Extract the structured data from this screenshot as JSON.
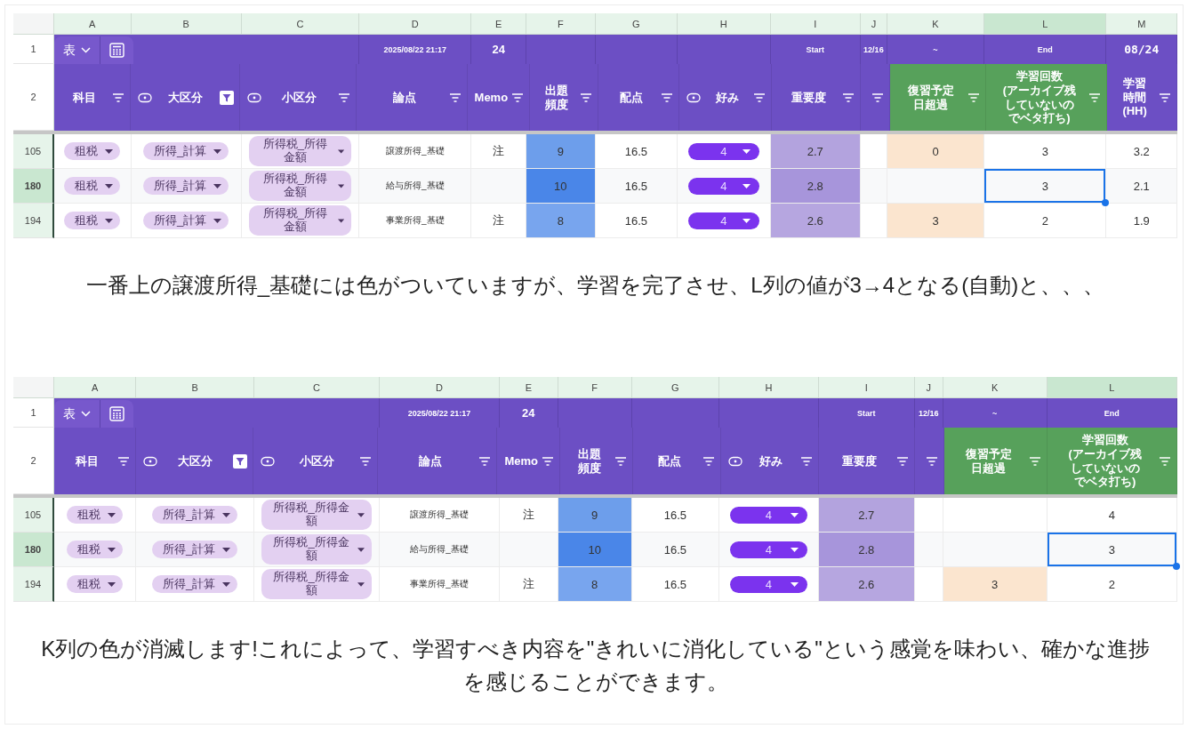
{
  "blocks": [
    {
      "kind": "sheet",
      "columns": [
        {
          "letter": "A",
          "selected": false
        },
        {
          "letter": "B",
          "selected": false
        },
        {
          "letter": "C",
          "selected": false
        },
        {
          "letter": "D",
          "selected": false
        },
        {
          "letter": "E",
          "selected": false
        },
        {
          "letter": "F",
          "selected": false
        },
        {
          "letter": "G",
          "selected": false
        },
        {
          "letter": "H",
          "selected": false
        },
        {
          "letter": "I",
          "selected": false
        },
        {
          "letter": "J",
          "selected": false
        },
        {
          "letter": "K",
          "selected": false
        },
        {
          "letter": "L",
          "selected": true
        },
        {
          "letter": "M",
          "selected": false
        }
      ],
      "row1": {
        "number": "1",
        "cells": [
          {
            "kind": "toolbar",
            "label": "表"
          },
          {
            "kind": "empty"
          },
          {
            "kind": "small",
            "text": "2025/08/22 21:17"
          },
          {
            "kind": "bold",
            "text": "24"
          },
          {
            "kind": "empty"
          },
          {
            "kind": "empty"
          },
          {
            "kind": "empty"
          },
          {
            "kind": "small",
            "text": "Start"
          },
          {
            "kind": "small",
            "text": "12/16"
          },
          {
            "kind": "small",
            "text": "~"
          },
          {
            "kind": "small",
            "text": "End"
          },
          {
            "kind": "mono",
            "text": "08/24"
          }
        ]
      },
      "row2": {
        "number": "2",
        "cells": [
          {
            "label": [
              "科目"
            ],
            "filtered": false,
            "color": "#6c4fc4"
          },
          {
            "label": [
              "大区分"
            ],
            "chip_icon": true,
            "filtered": true,
            "color": "#6c4fc4"
          },
          {
            "label": [
              "小区分"
            ],
            "chip_icon": true,
            "filtered": false,
            "color": "#6c4fc4"
          },
          {
            "label": [
              "論点"
            ],
            "filtered": false,
            "color": "#6c4fc4"
          },
          {
            "label": [
              "Memo"
            ],
            "filtered": false,
            "color": "#6c4fc4"
          },
          {
            "label": [
              "出題",
              "頻度"
            ],
            "filtered": false,
            "color": "#6c4fc4"
          },
          {
            "label": [
              "配点"
            ],
            "filtered": false,
            "color": "#6c4fc4"
          },
          {
            "label": [
              "好み"
            ],
            "chip_icon": true,
            "filtered": false,
            "color": "#6c4fc4"
          },
          {
            "label": [
              "重要度"
            ],
            "filtered": false,
            "color": "#6c4fc4"
          },
          {
            "filtered": false,
            "color": "#6c4fc4"
          },
          {
            "label": [
              "復習予定",
              "日超過"
            ],
            "filtered": false,
            "color": "#57a15b"
          },
          {
            "label": [
              "学習回数",
              "(アーカイブ残",
              "していないの",
              "でベタ打ち)"
            ],
            "filtered": false,
            "color": "#57a15b"
          },
          {
            "label": [
              "学習",
              "時間",
              "(HH)"
            ],
            "filtered": false,
            "color": "#6c4fc4"
          }
        ]
      },
      "rows": [
        {
          "number": "105",
          "selected": false,
          "cells": [
            {
              "kind": "chip",
              "text": "租税",
              "selected": false
            },
            {
              "kind": "chip",
              "text": "所得_計算",
              "selected": false
            },
            {
              "kind": "chip",
              "text": "所得税_所得金額",
              "selected": false
            },
            {
              "kind": "small",
              "text": "譲渡所得_基礎",
              "selected": false
            },
            {
              "kind": "text",
              "text": "注",
              "selected": false
            },
            {
              "kind": "text",
              "text": "9",
              "color": "#6d9eeb",
              "selected": false
            },
            {
              "kind": "text",
              "text": "16.5",
              "selected": false
            },
            {
              "kind": "dropdown",
              "text": "4",
              "selected": false
            },
            {
              "kind": "text",
              "text": "2.7",
              "color": "#b3a3de",
              "selected": false
            },
            {
              "kind": "empty",
              "selected": false
            },
            {
              "kind": "text",
              "text": "0",
              "color": "#fbe5cf",
              "selected": false
            },
            {
              "kind": "text",
              "text": "3",
              "selected": false
            },
            {
              "kind": "text",
              "text": "3.2",
              "selected": false
            }
          ]
        },
        {
          "number": "180",
          "selected": true,
          "cells": [
            {
              "kind": "chip",
              "text": "租税",
              "selected": false
            },
            {
              "kind": "chip",
              "text": "所得_計算",
              "selected": false
            },
            {
              "kind": "chip",
              "text": "所得税_所得金額",
              "selected": false
            },
            {
              "kind": "small",
              "text": "給与所得_基礎",
              "selected": false
            },
            {
              "kind": "empty",
              "selected": false
            },
            {
              "kind": "text",
              "text": "10",
              "color": "#4a86e8",
              "selected": false
            },
            {
              "kind": "text",
              "text": "16.5",
              "selected": false
            },
            {
              "kind": "dropdown",
              "text": "4",
              "selected": false
            },
            {
              "kind": "text",
              "text": "2.8",
              "color": "#a795db",
              "selected": false
            },
            {
              "kind": "empty",
              "selected": false
            },
            {
              "kind": "empty",
              "selected": false
            },
            {
              "kind": "text",
              "text": "3",
              "selected": true
            },
            {
              "kind": "text",
              "text": "2.1",
              "selected": false
            }
          ]
        },
        {
          "number": "194",
          "selected": false,
          "cells": [
            {
              "kind": "chip",
              "text": "租税",
              "selected": false
            },
            {
              "kind": "chip",
              "text": "所得_計算",
              "selected": false
            },
            {
              "kind": "chip",
              "text": "所得税_所得金額",
              "selected": false
            },
            {
              "kind": "small",
              "text": "事業所得_基礎",
              "selected": false
            },
            {
              "kind": "text",
              "text": "注",
              "selected": false
            },
            {
              "kind": "text",
              "text": "8",
              "color": "#78a5ee",
              "selected": false
            },
            {
              "kind": "text",
              "text": "16.5",
              "selected": false
            },
            {
              "kind": "dropdown",
              "text": "4",
              "selected": false
            },
            {
              "kind": "text",
              "text": "2.6",
              "color": "#b6a6e0",
              "selected": false
            },
            {
              "kind": "empty",
              "selected": false
            },
            {
              "kind": "text",
              "text": "3",
              "color": "#fbe5cf",
              "selected": false
            },
            {
              "kind": "text",
              "text": "2",
              "selected": false
            },
            {
              "kind": "text",
              "text": "1.9",
              "selected": false
            }
          ]
        }
      ]
    },
    {
      "kind": "caption",
      "text": "一番上の譲渡所得_基礎には色がついていますが、学習を完了させ、L列の値が3→4となる(自動)と、、、"
    },
    {
      "kind": "sheet",
      "columns": [
        {
          "letter": "A",
          "selected": false
        },
        {
          "letter": "B",
          "selected": false
        },
        {
          "letter": "C",
          "selected": false
        },
        {
          "letter": "D",
          "selected": false
        },
        {
          "letter": "E",
          "selected": false
        },
        {
          "letter": "F",
          "selected": false
        },
        {
          "letter": "G",
          "selected": false
        },
        {
          "letter": "H",
          "selected": false
        },
        {
          "letter": "I",
          "selected": false
        },
        {
          "letter": "J",
          "selected": false
        },
        {
          "letter": "K",
          "selected": false
        },
        {
          "letter": "L",
          "selected": true
        }
      ],
      "row1": {
        "number": "1",
        "cells": [
          {
            "kind": "toolbar",
            "label": "表"
          },
          {
            "kind": "empty"
          },
          {
            "kind": "small",
            "text": "2025/08/22 21:17"
          },
          {
            "kind": "bold",
            "text": "24"
          },
          {
            "kind": "empty"
          },
          {
            "kind": "empty"
          },
          {
            "kind": "empty"
          },
          {
            "kind": "small",
            "text": "Start"
          },
          {
            "kind": "small",
            "text": "12/16"
          },
          {
            "kind": "small",
            "text": "~"
          },
          {
            "kind": "small",
            "text": "End"
          }
        ]
      },
      "row2": {
        "number": "2",
        "cells": [
          {
            "label": [
              "科目"
            ],
            "filtered": false,
            "color": "#6c4fc4"
          },
          {
            "label": [
              "大区分"
            ],
            "chip_icon": true,
            "filtered": true,
            "color": "#6c4fc4"
          },
          {
            "label": [
              "小区分"
            ],
            "chip_icon": true,
            "filtered": false,
            "color": "#6c4fc4"
          },
          {
            "label": [
              "論点"
            ],
            "filtered": false,
            "color": "#6c4fc4"
          },
          {
            "label": [
              "Memo"
            ],
            "filtered": false,
            "color": "#6c4fc4"
          },
          {
            "label": [
              "出題",
              "頻度"
            ],
            "filtered": false,
            "color": "#6c4fc4"
          },
          {
            "label": [
              "配点"
            ],
            "filtered": false,
            "color": "#6c4fc4"
          },
          {
            "label": [
              "好み"
            ],
            "chip_icon": true,
            "filtered": false,
            "color": "#6c4fc4"
          },
          {
            "label": [
              "重要度"
            ],
            "filtered": false,
            "color": "#6c4fc4"
          },
          {
            "filtered": false,
            "color": "#6c4fc4"
          },
          {
            "label": [
              "復習予定",
              "日超過"
            ],
            "filtered": false,
            "color": "#57a15b"
          },
          {
            "label": [
              "学習回数",
              "(アーカイブ残",
              "していないの",
              "でベタ打ち)"
            ],
            "filtered": false,
            "color": "#57a15b"
          }
        ]
      },
      "rows": [
        {
          "number": "105",
          "selected": false,
          "cells": [
            {
              "kind": "chip",
              "text": "租税",
              "selected": false
            },
            {
              "kind": "chip",
              "text": "所得_計算",
              "selected": false
            },
            {
              "kind": "chip",
              "text": "所得税_所得金額",
              "selected": false
            },
            {
              "kind": "small",
              "text": "譲渡所得_基礎",
              "selected": false
            },
            {
              "kind": "text",
              "text": "注",
              "selected": false
            },
            {
              "kind": "text",
              "text": "9",
              "color": "#6d9eeb",
              "selected": false
            },
            {
              "kind": "text",
              "text": "16.5",
              "selected": false
            },
            {
              "kind": "dropdown",
              "text": "4",
              "selected": false
            },
            {
              "kind": "text",
              "text": "2.7",
              "color": "#b3a3de",
              "selected": false
            },
            {
              "kind": "empty",
              "selected": false
            },
            {
              "kind": "empty",
              "selected": false
            },
            {
              "kind": "text",
              "text": "4",
              "selected": false
            }
          ]
        },
        {
          "number": "180",
          "selected": true,
          "cells": [
            {
              "kind": "chip",
              "text": "租税",
              "selected": false
            },
            {
              "kind": "chip",
              "text": "所得_計算",
              "selected": false
            },
            {
              "kind": "chip",
              "text": "所得税_所得金額",
              "selected": false
            },
            {
              "kind": "small",
              "text": "給与所得_基礎",
              "selected": false
            },
            {
              "kind": "empty",
              "selected": false
            },
            {
              "kind": "text",
              "text": "10",
              "color": "#4a86e8",
              "selected": false
            },
            {
              "kind": "text",
              "text": "16.5",
              "selected": false
            },
            {
              "kind": "dropdown",
              "text": "4",
              "selected": false
            },
            {
              "kind": "text",
              "text": "2.8",
              "color": "#a795db",
              "selected": false
            },
            {
              "kind": "empty",
              "selected": false
            },
            {
              "kind": "empty",
              "selected": false
            },
            {
              "kind": "text",
              "text": "3",
              "selected": true
            }
          ]
        },
        {
          "number": "194",
          "selected": false,
          "cells": [
            {
              "kind": "chip",
              "text": "租税",
              "selected": false
            },
            {
              "kind": "chip",
              "text": "所得_計算",
              "selected": false
            },
            {
              "kind": "chip",
              "text": "所得税_所得金額",
              "selected": false
            },
            {
              "kind": "small",
              "text": "事業所得_基礎",
              "selected": false
            },
            {
              "kind": "text",
              "text": "注",
              "selected": false
            },
            {
              "kind": "text",
              "text": "8",
              "color": "#78a5ee",
              "selected": false
            },
            {
              "kind": "text",
              "text": "16.5",
              "selected": false
            },
            {
              "kind": "dropdown",
              "text": "4",
              "selected": false
            },
            {
              "kind": "text",
              "text": "2.6",
              "color": "#b6a6e0",
              "selected": false
            },
            {
              "kind": "empty",
              "selected": false
            },
            {
              "kind": "text",
              "text": "3",
              "color": "#fbe5cf",
              "selected": false
            },
            {
              "kind": "text",
              "text": "2",
              "selected": false
            }
          ]
        }
      ]
    },
    {
      "kind": "caption",
      "text": "K列の色が消滅します!これによって、学習すべき内容を\"きれいに消化している\"という感覚を味わい、確かな進捗を感じることができます。"
    }
  ]
}
